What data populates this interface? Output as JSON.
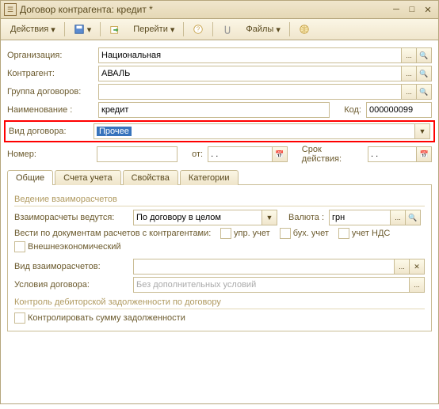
{
  "window": {
    "title": "Договор контрагента: кредит *"
  },
  "toolbar": {
    "actions": "Действия",
    "goto": "Перейти",
    "files": "Файлы"
  },
  "form": {
    "org_label": "Организация:",
    "org_value": "Национальная",
    "contr_label": "Контрагент:",
    "contr_value": "АВАЛЬ",
    "group_label": "Группа договоров:",
    "group_value": "",
    "name_label": "Наименование :",
    "name_value": "кредит",
    "code_label": "Код:",
    "code_value": "000000099",
    "type_label": "Вид договора:",
    "type_value": "Прочее",
    "number_label": "Номер:",
    "number_value": "",
    "date_from_label": "от:",
    "date_from_value": ". .",
    "validity_label": "Срок действия:",
    "validity_value": ". ."
  },
  "tabs": {
    "t1": "Общие",
    "t2": "Счета учета",
    "t3": "Свойства",
    "t4": "Категории"
  },
  "general": {
    "section1": "Ведение взаиморасчетов",
    "settle_label": "Взаиморасчеты ведутся:",
    "settle_value": "По договору в целом",
    "currency_label": "Валюта :",
    "currency_value": "грн",
    "keep_docs_label": "Вести по документам расчетов с контрагентами:",
    "chk_mgmt": "упр. учет",
    "chk_acc": "бух. учет",
    "chk_vat": "учет НДС",
    "chk_foreign": "Внешнеэкономический",
    "settle_type_label": "Вид взаиморасчетов:",
    "settle_type_value": "",
    "terms_label": "Условия договора:",
    "terms_placeholder": "Без дополнительных условий",
    "section2": "Контроль дебиторской задолженности по договору",
    "chk_control": "Контролировать сумму задолженности"
  }
}
